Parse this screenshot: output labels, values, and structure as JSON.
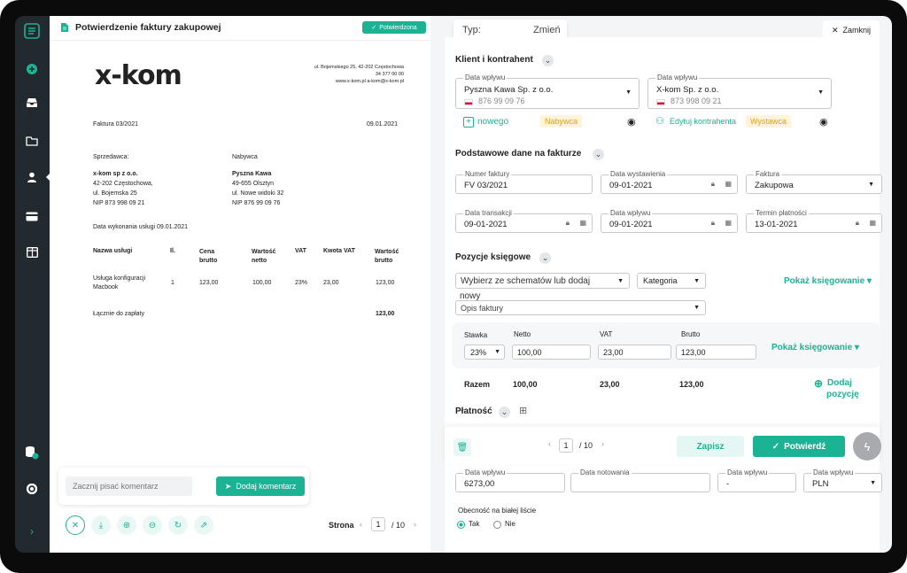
{
  "left": {
    "title": "Potwierdzenie faktury zakupowej",
    "badge": "Potwierdzona",
    "invoice": {
      "logo": "x-kom",
      "address_line1": "ul. Bojemskiego 25, 42-202 Częstochowa",
      "address_line2": "34 377 00 00",
      "address_line3": "www.x-kom.pl a-kom@x-kom.pl",
      "number": "Faktura 03/2021",
      "date": "09.01.2021",
      "seller_label": "Sprzedawca:",
      "seller_name": "x-kom sp z o.o.",
      "seller_line1": "42-202 Częstochowa,",
      "seller_line2": "ul. Bojemska 25",
      "seller_nip": "NIP 873 998 09 21",
      "buyer_label": "Nabywca",
      "buyer_name": "Pyszna Kawa",
      "buyer_line1": "49-655 Olsztyn",
      "buyer_line2": "ul. Nowe widoki 32",
      "buyer_nip": "NIP 876 99 09 76",
      "service_date": "Data  wykonania usługi 09.01.2021",
      "headers": [
        "Nazwa usługi",
        "Il.",
        "Cena brutto",
        "Wartość netto",
        "VAT",
        "Kwota VAT",
        "Wartość brutto"
      ],
      "row": [
        "Usługa konfiguracji Macbook",
        "1",
        "123,00",
        "100,00",
        "23%",
        "23,00",
        "123,00"
      ],
      "total_label": "Łącznie do zapłaty",
      "total_value": "123,00"
    },
    "comment_placeholder": "Zacznij pisać komentarz",
    "comment_button": "Dodaj komentarz",
    "page_label": "Strona",
    "page_current": "1",
    "page_total": "/ 10"
  },
  "right": {
    "type_label": "Typ:",
    "type_change": "Zmień",
    "close": "Zamknij",
    "client_section": "Klient i kontrahent",
    "buyer_field_label": "Data wpływu",
    "buyer_field_value": "Pyszna Kawa Sp. z o.o.",
    "buyer_field_nip": "876 99 09 76",
    "seller_field_label": "Data wpływu",
    "seller_field_value": "X-kom Sp. z o.o.",
    "seller_field_nip": "873 998 09 21",
    "new_link": "nowego",
    "buyer_tag": "Nabywca",
    "edit_link": "Edytuj kontrahenta",
    "seller_tag": "Wystawca",
    "basic_section": "Podstawowe dane na fakturze",
    "invoice_number_label": "Numer faktury",
    "invoice_number": "FV 03/2021",
    "issue_date_label": "Data wystawienia",
    "issue_date": "09-01-2021",
    "invoice_type_label": "Faktura",
    "invoice_type": "Zakupowa",
    "transaction_label": "Data transakcji",
    "transaction_date": "09-01-2021",
    "receipt_label": "Data wpływu",
    "receipt_date": "09-01-2021",
    "due_label": "Termin płatności",
    "due_date": "13-01-2021",
    "posting_section": "Pozycje księgowe",
    "scheme_placeholder_1": "Wybierz ze schematów lub dodaj",
    "scheme_placeholder_2": "nowy",
    "category": "Kategoria",
    "show_posting": "Pokaż księgowanie ▾",
    "invoice_desc": "Opis faktury",
    "rate_label": "Stawka",
    "net_label": "Netto",
    "vat_label": "VAT",
    "gross_label": "Brutto",
    "rate": "23%",
    "net": "100,00",
    "vat": "23,00",
    "gross": "123,00",
    "total_label": "Razem",
    "total_net": "100,00",
    "total_vat": "23,00",
    "total_gross": "123,00",
    "add_line_1": "Dodaj",
    "add_line_2": "pozycję",
    "payment_section": "Płatność",
    "pager_current": "1",
    "pager_total": "/ 10",
    "save": "Zapisz",
    "confirm": "Potwierdź",
    "pay_amount_label": "Data wpływu",
    "pay_amount": "6273,00",
    "quote_label": "Data notowania",
    "rate2_label": "Data wpływu",
    "rate2_value": "-",
    "currency_label": "Data wpływu",
    "currency": "PLN",
    "whitelist_label": "Obecność na białej liście",
    "yes": "Tak",
    "no": "Nie"
  },
  "colors": {
    "accent": "#1bb394",
    "sidebar": "#22292f",
    "tag_bg": "#fff3d9",
    "tag_fg": "#e0a31a"
  }
}
